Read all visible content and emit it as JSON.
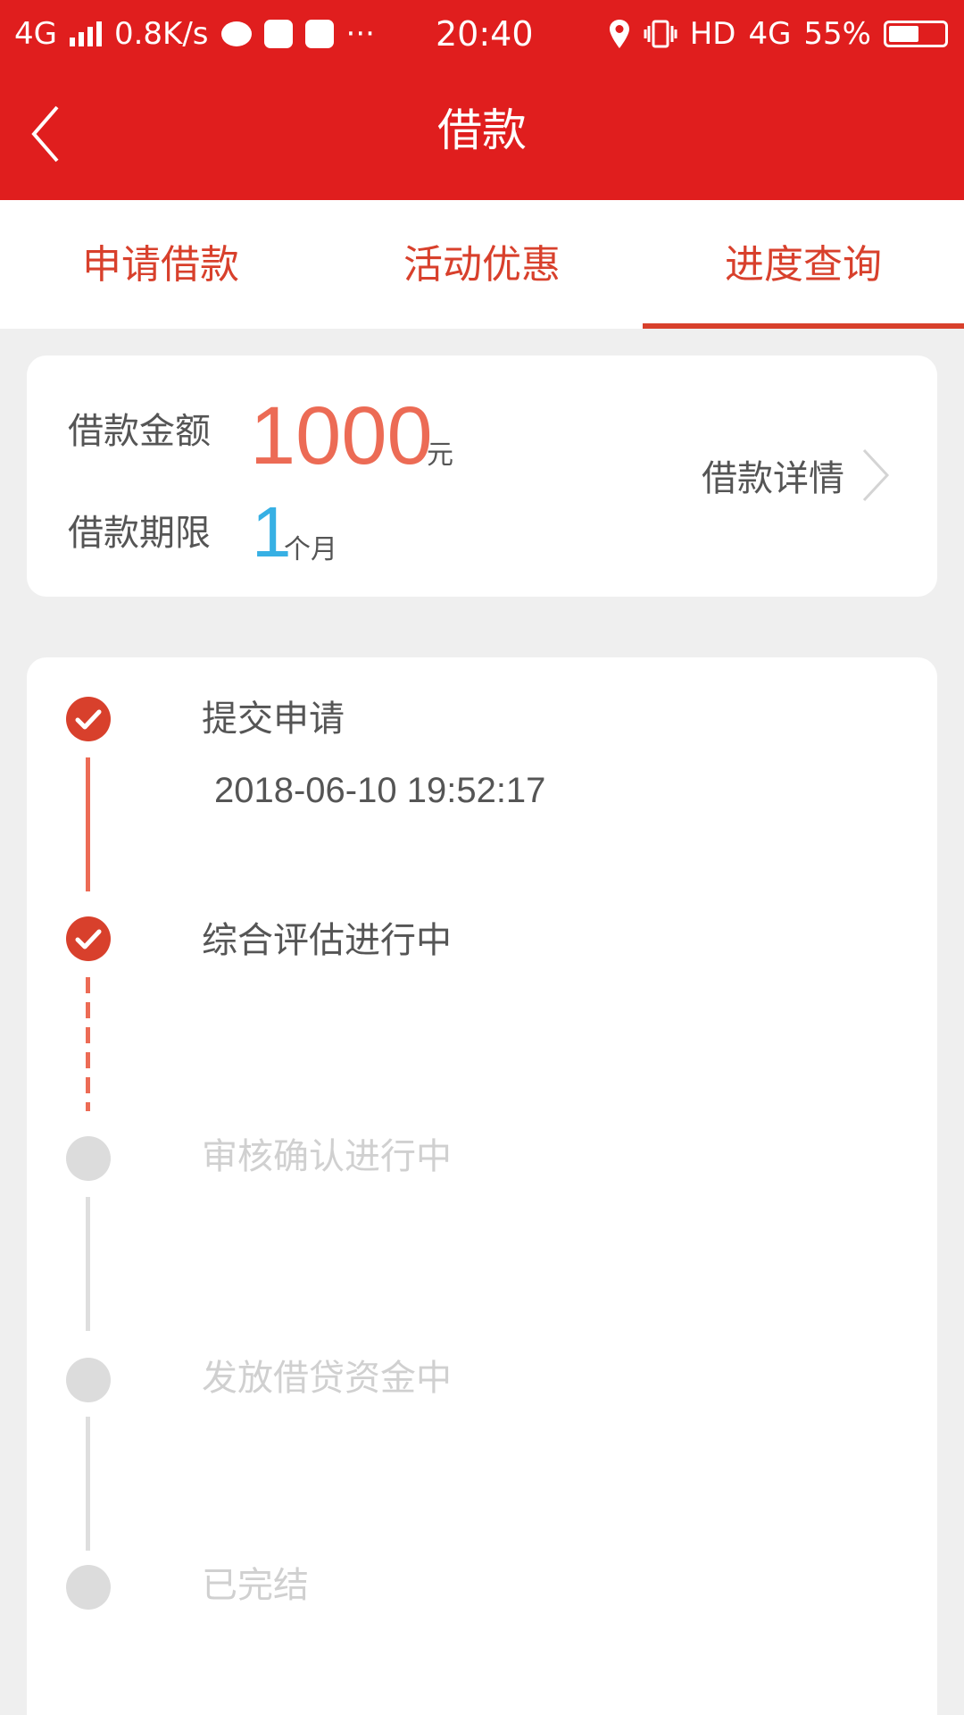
{
  "status_bar": {
    "network_left": "4G",
    "speed": "0.8K/s",
    "more": "···",
    "time": "20:40",
    "hd": "HD",
    "network_right": "4G",
    "battery": "55%",
    "battery_level": 0.55,
    "icons": [
      "signal-bars-icon",
      "chat-bubble-icon",
      "speedometer-app-icon",
      "vivo-app-icon",
      "location-pin-icon",
      "vibrate-icon",
      "battery-icon"
    ]
  },
  "header": {
    "title": "借款",
    "back_icon": "chevron-left-icon",
    "color": "#e01e1e"
  },
  "tabs": [
    {
      "label": "申请借款",
      "active": false
    },
    {
      "label": "活动优惠",
      "active": false
    },
    {
      "label": "进度查询",
      "active": true
    }
  ],
  "summary": {
    "amount_label": "借款金额",
    "amount_value": "1000",
    "amount_unit": "元",
    "term_label": "借款期限",
    "term_value": "1",
    "term_unit": "个月",
    "detail_link": "借款详情",
    "amount_color": "#ec6b55",
    "term_color": "#37b0e4"
  },
  "steps": [
    {
      "label": "提交申请",
      "time": "2018-06-10 19:52:17",
      "status": "done"
    },
    {
      "label": "综合评估进行中",
      "status": "done"
    },
    {
      "label": "审核确认进行中",
      "status": "pending"
    },
    {
      "label": "发放借贷资金中",
      "status": "pending"
    },
    {
      "label": "已完结",
      "status": "pending"
    }
  ],
  "colors": {
    "accent": "#d8402c",
    "pending": "#dcdcdc",
    "background": "#efefef"
  }
}
